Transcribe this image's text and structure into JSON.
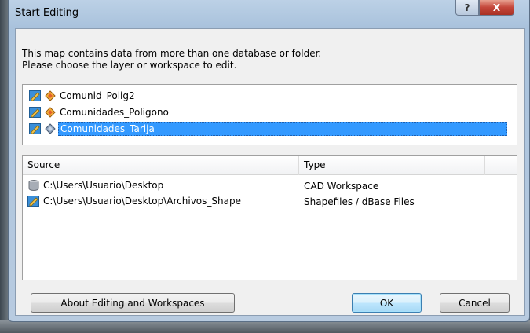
{
  "window": {
    "title": "Start Editing",
    "help_label": "?",
    "close_label": "X"
  },
  "intro": {
    "line1": "This map contains data from more than one database or folder.",
    "line2": "Please choose the layer or workspace to edit."
  },
  "layers": [
    {
      "label": "Comunid_Polig2",
      "selected": false,
      "icon": "polygon-layer-icon"
    },
    {
      "label": "Comunidades_Poligono",
      "selected": false,
      "icon": "polygon-layer-icon"
    },
    {
      "label": "Comunidades_Tarija",
      "selected": true,
      "icon": "cad-layer-icon"
    }
  ],
  "sources_table": {
    "headers": {
      "source": "Source",
      "type": "Type"
    },
    "rows": [
      {
        "source": "C:\\Users\\Usuario\\Desktop",
        "type": "CAD Workspace",
        "icon": "database-icon"
      },
      {
        "source": "C:\\Users\\Usuario\\Desktop\\Archivos_Shape",
        "type": "Shapefiles / dBase Files",
        "icon": "shapefile-folder-icon"
      }
    ]
  },
  "buttons": {
    "about": "About Editing and Workspaces",
    "ok": "OK",
    "cancel": "Cancel"
  },
  "colors": {
    "selection": "#3399ff",
    "close_button": "#c4463a"
  }
}
